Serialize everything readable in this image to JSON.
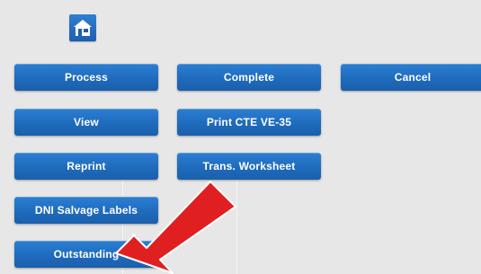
{
  "home": {
    "icon": "home-icon"
  },
  "buttons": {
    "process": "Process",
    "complete": "Complete",
    "cancel": "Cancel",
    "view": "View",
    "print_cte": "Print CTE VE-35",
    "reprint": "Reprint",
    "trans_worksheet": "Trans. Worksheet",
    "dni_salvage": "DNI Salvage Labels",
    "outstanding": "Outstanding"
  },
  "annotation": {
    "arrow_color": "#e02020",
    "icon": "red-arrow-icon"
  },
  "colors": {
    "button": "#1f6bbd",
    "background": "#e7e7e7"
  }
}
